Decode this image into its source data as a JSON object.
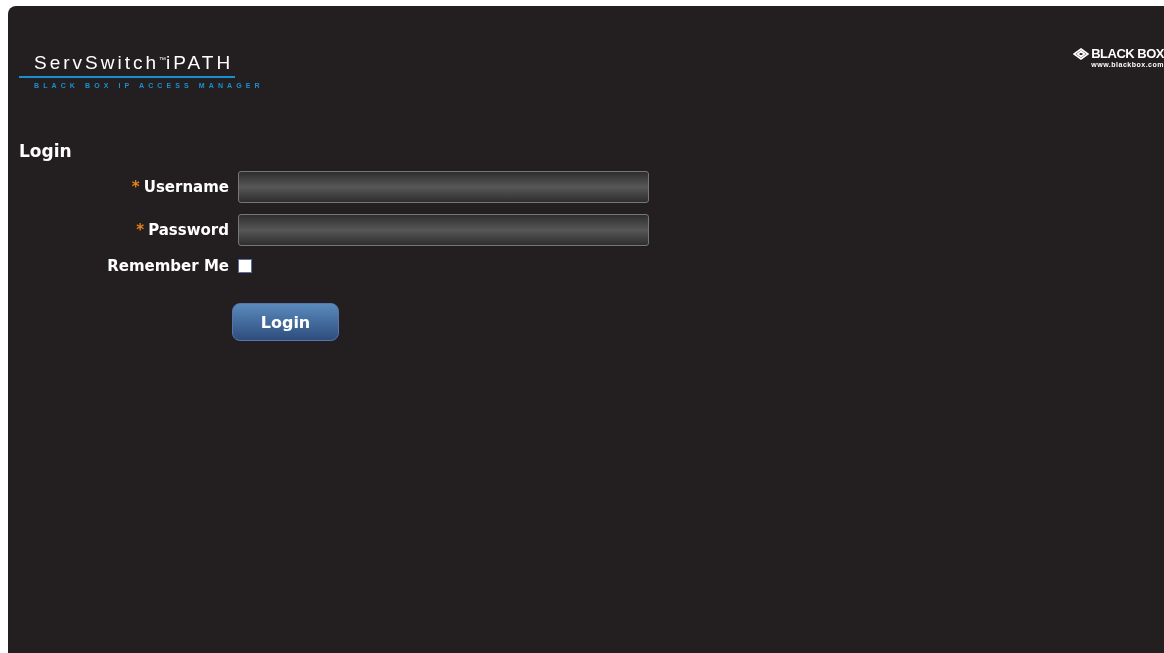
{
  "logo": {
    "name": "ServSwitch",
    "trademark": "™",
    "product": "iPATH",
    "tagline": "BLACK BOX IP ACCESS MANAGER"
  },
  "brand": {
    "name": "BLACK BOX",
    "url": "www.blackbox.com"
  },
  "heading": "Login",
  "fields": [
    {
      "label": "Username",
      "required_mark": "*"
    },
    {
      "label": "Password",
      "required_mark": "*"
    }
  ],
  "remember": {
    "label": "Remember Me",
    "checked": false
  },
  "button": "Login"
}
